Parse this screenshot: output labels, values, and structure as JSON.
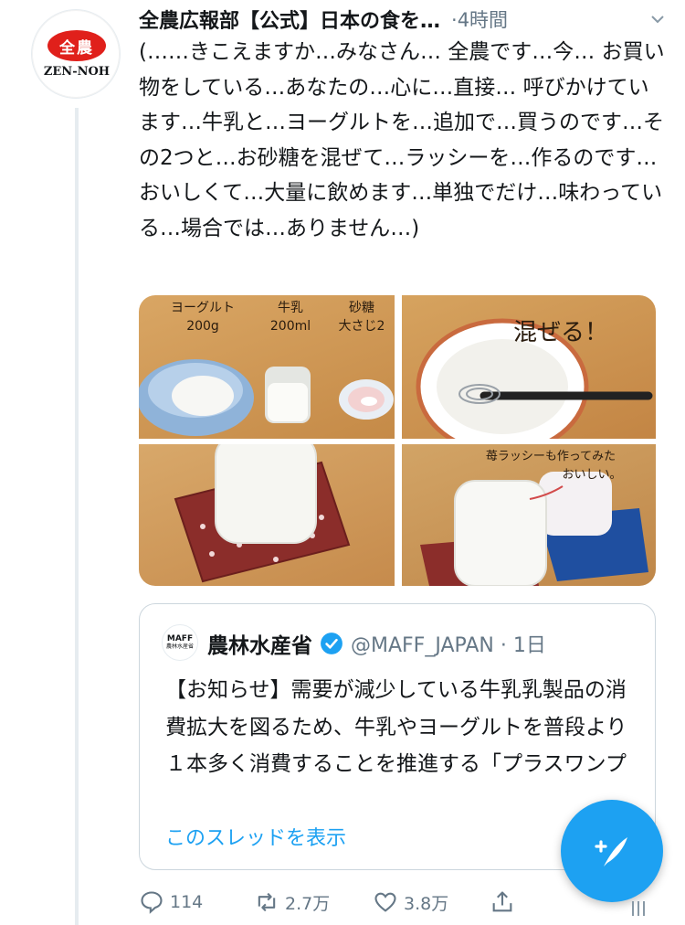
{
  "tweet": {
    "display_name": "全農広報部【公式】日本の食を…",
    "time": "·4時間",
    "text": "(……きこえますか…みなさん… 全農です…今… お買い物をしている…あなたの…心に…直接… 呼びかけています…牛乳と…ヨーグルトを…追加で…買うのです…その2つと…お砂糖を混ぜて…ラッシーを…作るのです…おいしくて…大量に飲めます…単独でだけ…味わっている…場合では…ありません…)",
    "avatar": {
      "logo_text": "全農",
      "brand_text": "ZEN-NOH",
      "logo_color": "#e0201b"
    }
  },
  "media": {
    "image1": {
      "yogurt_label": "ヨーグルト",
      "yogurt_amount": "200g",
      "milk_label": "牛乳",
      "milk_amount": "200ml",
      "sugar_label": "砂糖",
      "sugar_amount": "大さじ2"
    },
    "image2": {
      "caption": "混ぜる！"
    },
    "image4": {
      "note_line1": "苺ラッシーも作ってみた",
      "note_line2": "おいしい。"
    }
  },
  "quote": {
    "avatar_line1": "MAFF",
    "avatar_line2": "農林水産省",
    "name": "農林水産省",
    "handle_time": "@MAFF_JAPAN · 1日",
    "text": "【お知らせ】需要が減少している牛乳乳製品の消費拡大を図るため、牛乳やヨーグルトを普段より１本多く消費することを推進する「プラスワンプロジェクト",
    "show_thread": "このスレッドを表示"
  },
  "actions": {
    "replies": "114",
    "retweets": "2.7万",
    "likes": "3.8万"
  },
  "colors": {
    "accent": "#1da1f2",
    "muted": "#657786",
    "text": "#14171a",
    "border": "#ccd6dd"
  }
}
